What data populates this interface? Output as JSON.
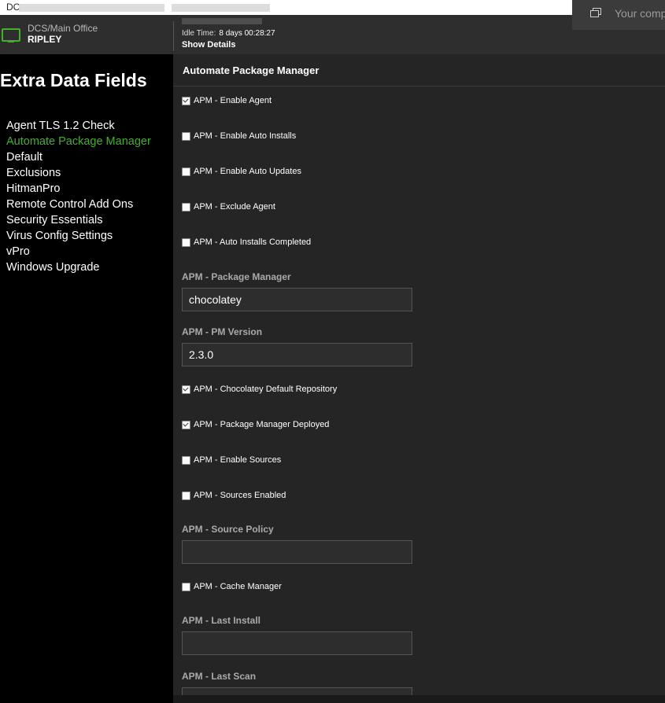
{
  "browser": {
    "title_fragment": "DC",
    "notification_text": "Your comp"
  },
  "header": {
    "location": "DCS/Main Office",
    "computer": "RIPLEY",
    "idle_label": "Idle Time:",
    "idle_value": "8 days 00:28:27",
    "show_details": "Show Details"
  },
  "sidebar": {
    "title": "Extra Data Fields",
    "items": [
      {
        "label": "Agent TLS 1.2 Check",
        "active": false
      },
      {
        "label": "Automate Package Manager",
        "active": true
      },
      {
        "label": "Default",
        "active": false
      },
      {
        "label": "Exclusions",
        "active": false
      },
      {
        "label": "HitmanPro",
        "active": false
      },
      {
        "label": "Remote Control Add Ons",
        "active": false
      },
      {
        "label": "Security Essentials",
        "active": false
      },
      {
        "label": "Virus Config Settings",
        "active": false
      },
      {
        "label": "vPro",
        "active": false
      },
      {
        "label": "Windows Upgrade",
        "active": false
      }
    ]
  },
  "main": {
    "title": "Automate Package Manager",
    "fields": [
      {
        "type": "checkbox",
        "label": "APM - Enable Agent",
        "checked": true
      },
      {
        "type": "checkbox",
        "label": "APM - Enable Auto Installs",
        "checked": false
      },
      {
        "type": "checkbox",
        "label": "APM - Enable Auto Updates",
        "checked": false
      },
      {
        "type": "checkbox",
        "label": "APM - Exclude Agent",
        "checked": false
      },
      {
        "type": "checkbox",
        "label": "APM - Auto Installs Completed",
        "checked": false
      },
      {
        "type": "text",
        "label": "APM - Package Manager",
        "value": "chocolatey"
      },
      {
        "type": "text",
        "label": "APM - PM Version",
        "value": "2.3.0"
      },
      {
        "type": "checkbox",
        "label": "APM - Chocolatey Default Repository",
        "checked": true
      },
      {
        "type": "checkbox",
        "label": "APM - Package Manager Deployed",
        "checked": true
      },
      {
        "type": "checkbox",
        "label": "APM - Enable Sources",
        "checked": false
      },
      {
        "type": "checkbox",
        "label": "APM - Sources Enabled",
        "checked": false
      },
      {
        "type": "text",
        "label": "APM - Source Policy",
        "value": ""
      },
      {
        "type": "checkbox",
        "label": "APM - Cache Manager",
        "checked": false
      },
      {
        "type": "text",
        "label": "APM - Last Install",
        "value": ""
      },
      {
        "type": "text",
        "label": "APM - Last Scan",
        "value": ""
      }
    ]
  },
  "colors": {
    "accent_green": "#43b02a",
    "panel_bg": "#252525",
    "header_bg": "#2e2e2e"
  }
}
